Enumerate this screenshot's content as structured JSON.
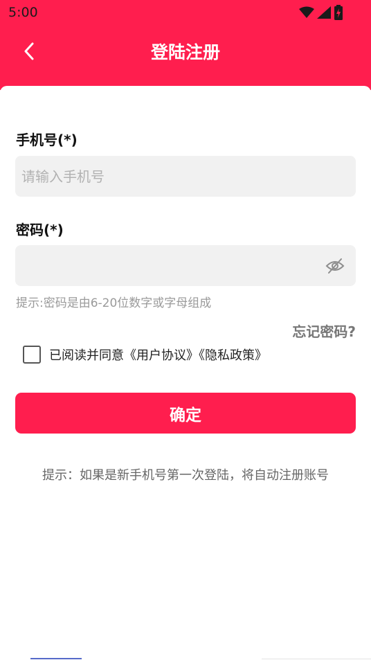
{
  "status_bar": {
    "time": "5:00",
    "icons": [
      "wifi-icon",
      "cell-signal-icon",
      "battery-charging-icon"
    ]
  },
  "header": {
    "title": "登陆注册",
    "back_icon": "chevron-left-icon",
    "background": "#ff1e4e"
  },
  "form": {
    "phone_label": "手机号(*)",
    "phone_placeholder": "请输入手机号",
    "phone_value": "",
    "password_label": "密码(*)",
    "password_placeholder": "",
    "password_value": "",
    "password_toggle_icon": "eye-off-icon",
    "password_hint": "提示:密码是由6-20位数字或字母组成",
    "forgot_password": "忘记密码?"
  },
  "agreement": {
    "checked": false,
    "text": "已阅读并同意《用户协议》《隐私政策》"
  },
  "confirm_button": "确定",
  "bottom_tip": "提示：如果是新手机号第一次登陆，将自动注册账号",
  "colors": {
    "accent": "#ff1e4e",
    "field_bg": "#f1f1f1",
    "hint": "#9a9a9a"
  }
}
